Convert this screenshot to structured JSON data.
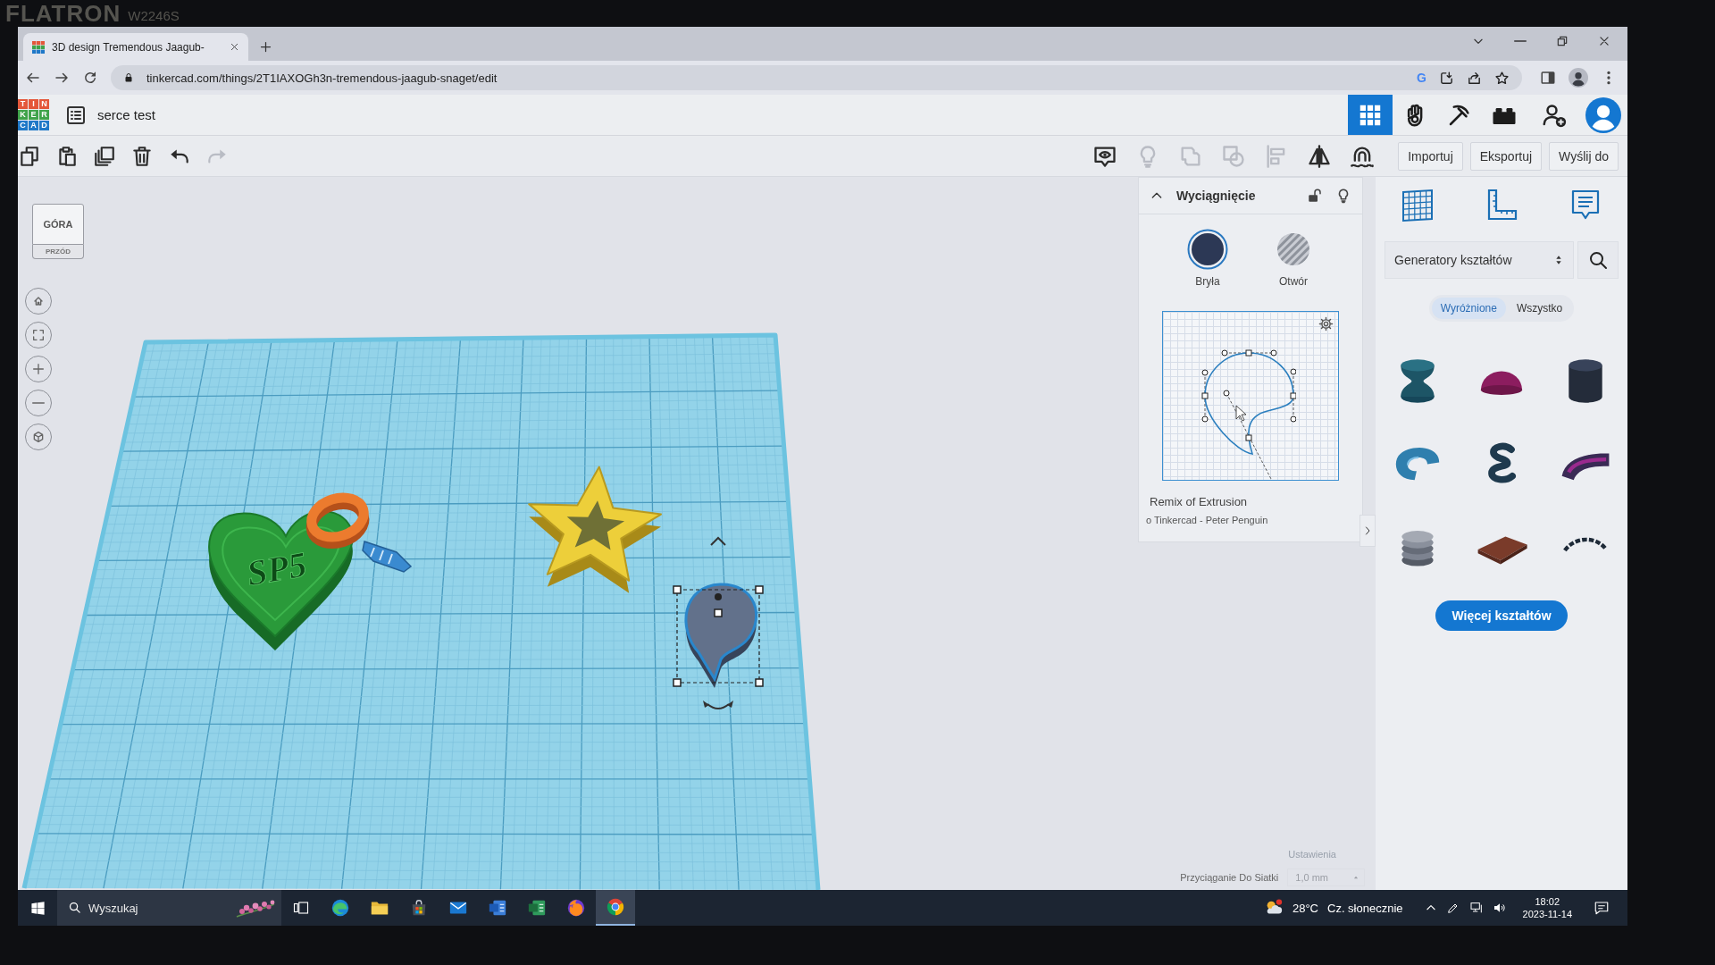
{
  "monitor": {
    "brand": "FLATRON",
    "model": "W2246S"
  },
  "browser": {
    "tabs": [
      {
        "title": "3D design Tremendous Jaagub-",
        "selected": true
      }
    ],
    "url": "tinkercad.com/things/2T1IAXOGh3n-tremendous-jaagub-snaget/edit",
    "extension_letter": "G"
  },
  "app": {
    "logo": [
      "T",
      "I",
      "N",
      "K",
      "E",
      "R",
      "C",
      "A",
      "D"
    ],
    "design_name": "serce test",
    "modes": [
      {
        "kind": "grid",
        "selected": true
      },
      {
        "kind": "glove",
        "selected": false
      },
      {
        "kind": "pickaxe",
        "selected": false
      },
      {
        "kind": "brick",
        "selected": false
      }
    ],
    "edit_tools": [
      {
        "kind": "copy",
        "disabled": false
      },
      {
        "kind": "paste",
        "disabled": false
      },
      {
        "kind": "duplicate",
        "disabled": false
      },
      {
        "kind": "delete",
        "disabled": false
      },
      {
        "kind": "undo",
        "disabled": false
      },
      {
        "kind": "redo",
        "disabled": true
      }
    ],
    "view_tools": [
      {
        "kind": "note",
        "disabled": false
      },
      {
        "kind": "bulb",
        "disabled": true
      },
      {
        "kind": "group",
        "disabled": true
      },
      {
        "kind": "ungroup",
        "disabled": true
      },
      {
        "kind": "align",
        "disabled": true
      },
      {
        "kind": "mirror",
        "disabled": false
      },
      {
        "kind": "magnet",
        "disabled": false
      }
    ],
    "actions": [
      "Importuj",
      "Eksportuj",
      "Wyślij do"
    ]
  },
  "view_cube": {
    "top": "GÓRA",
    "front": "PRZÓD"
  },
  "scene": {
    "heart_text": "SP5"
  },
  "inspector": {
    "title": "Wyciągnięcie",
    "expanded": true,
    "locked": false,
    "modes": [
      {
        "kind": "solid",
        "label": "Bryła",
        "selected": true
      },
      {
        "kind": "hole",
        "label": "Otwór",
        "selected": false
      }
    ],
    "shape_title": "Remix of Extrusion",
    "author": "o Tinkercad - Peter Penguin"
  },
  "library": {
    "category": "Generatory kształtów",
    "tabs": [
      {
        "label": "Wyróżnione",
        "selected": true
      },
      {
        "label": "Wszystko",
        "selected": false
      }
    ],
    "more_button": "Więcej kształtów"
  },
  "settings": {
    "link": "Ustawienia",
    "snap_label": "Przyciąganie Do Siatki",
    "snap_value": "1,0 mm"
  },
  "taskbar": {
    "search": {
      "placeholder": "Wyszukaj"
    },
    "apps": [
      {
        "kind": "edge",
        "selected": false
      },
      {
        "kind": "explorer",
        "selected": false
      },
      {
        "kind": "store",
        "selected": false
      },
      {
        "kind": "mail",
        "selected": false
      },
      {
        "kind": "word",
        "selected": false
      },
      {
        "kind": "excel",
        "selected": false
      },
      {
        "kind": "firefox",
        "selected": false
      },
      {
        "kind": "chrome",
        "selected": true
      }
    ],
    "weather": {
      "temperature": "28°C",
      "condition": "Cz. słonecznie"
    },
    "time": "18:02",
    "date": "2023-11-14"
  }
}
